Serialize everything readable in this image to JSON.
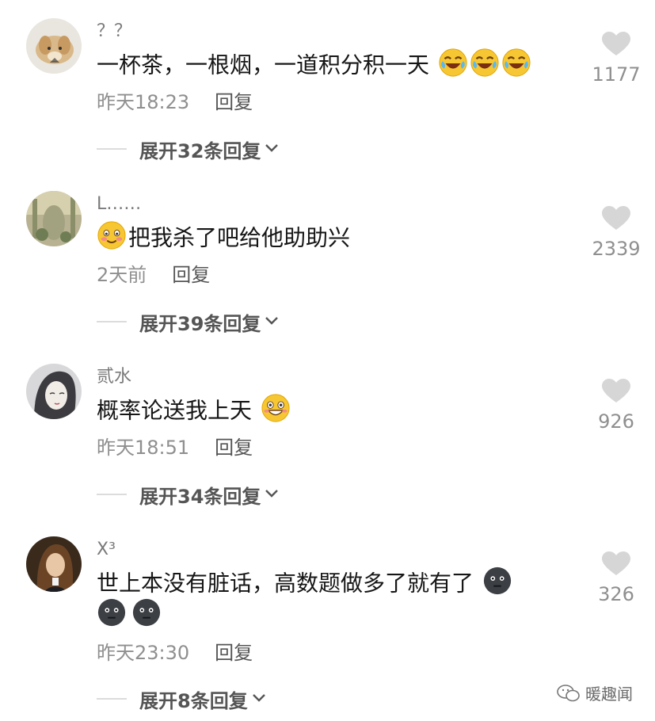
{
  "comments": [
    {
      "username": "？？",
      "text": "一杯茶，一根烟，一道积分积一天",
      "time": "昨天18:23",
      "reply": "回复",
      "expand": "展开32条回复",
      "likes": "1177",
      "emoji": "laugh-cry-emoji",
      "emoji_count": 3
    },
    {
      "username": "L……",
      "text": "把我杀了吧给他助助兴",
      "time": "2天前",
      "reply": "回复",
      "expand": "展开39条回复",
      "likes": "2339",
      "emoji": "smile-emoji",
      "emoji_count": 1
    },
    {
      "username": "贰水",
      "text": "概率论送我上天",
      "time": "昨天18:51",
      "reply": "回复",
      "expand": "展开34条回复",
      "likes": "926",
      "emoji": "grin-emoji",
      "emoji_count": 1
    },
    {
      "username": "X³",
      "text": "世上本没有脏话，高数题做多了就有了",
      "time": "昨天23:30",
      "reply": "回复",
      "expand": "展开8条回复",
      "likes": "326",
      "emoji": "dark-face-emoji",
      "emoji_count": 3
    }
  ],
  "watermark": {
    "icon": "wechat-icon",
    "text": "暖趣闻"
  },
  "colors": {
    "like_heart": "#d6d6d6",
    "meta": "#8f8f8f",
    "emoji_yellow": "#f7c733",
    "dark_emoji": "#3c3f44"
  }
}
